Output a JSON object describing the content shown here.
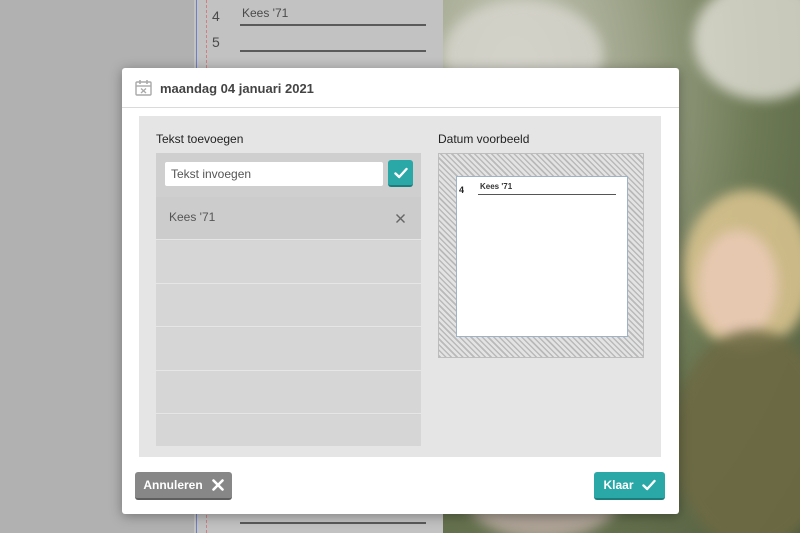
{
  "background": {
    "calendar_rows": [
      {
        "day": "4",
        "text": "Kees '71"
      },
      {
        "day": "5",
        "text": ""
      }
    ],
    "accent_color": "#2aa7a7"
  },
  "dialog": {
    "title": "maandag 04 januari 2021",
    "title_icon": "calendar-icon",
    "left_section_label": "Tekst toevoegen",
    "right_section_label": "Datum voorbeeld",
    "input": {
      "placeholder": "Tekst invoegen",
      "value": ""
    },
    "confirm_icon": "checkmark-icon",
    "entries": [
      {
        "text": "Kees '71",
        "delete_icon": "close-icon"
      }
    ],
    "preview": {
      "day": "4",
      "text": "Kees '71"
    },
    "cancel_label": "Annuleren",
    "done_label": "Klaar"
  }
}
